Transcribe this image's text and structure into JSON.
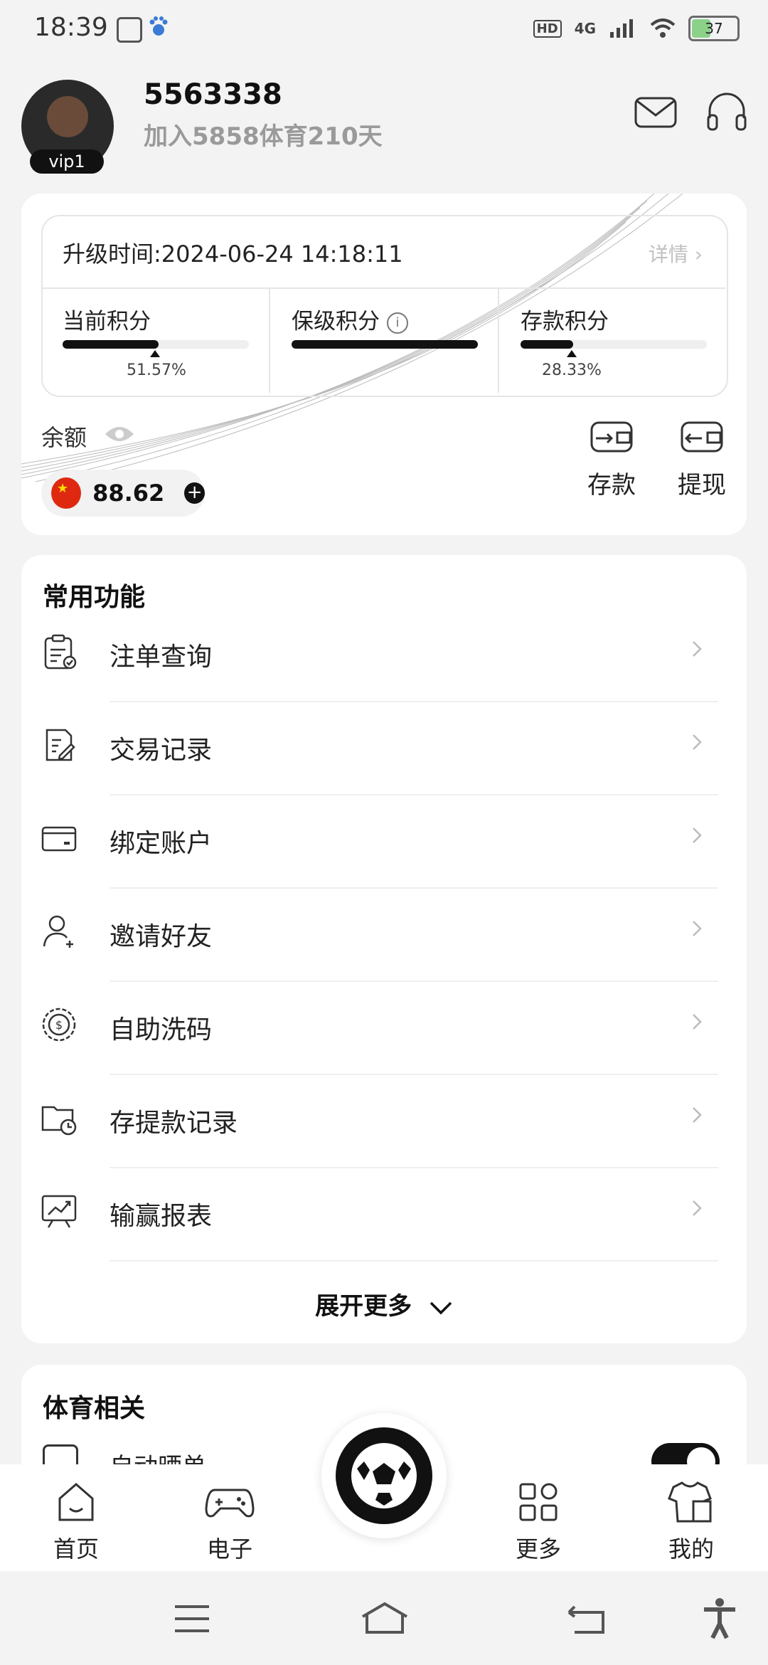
{
  "status_bar": {
    "time": "18:39",
    "network": "4G",
    "hd": "HD",
    "battery": "37"
  },
  "header": {
    "vip_level": "vip1",
    "user_id": "5563338",
    "join_text": "加入5858体育210天",
    "mail_icon": "mail-icon",
    "support_icon": "headset-icon"
  },
  "vip_card": {
    "upgrade_time": "升级时间:2024-06-24 14:18:11",
    "detail_label": "详情",
    "metrics": [
      {
        "label": "当前积分",
        "progress": 0.5157,
        "percent_text": "51.57%"
      },
      {
        "label": "保级积分",
        "progress": 1.0,
        "percent_text": ""
      },
      {
        "label": "存款积分",
        "progress": 0.2833,
        "percent_text": "28.33%"
      }
    ],
    "balance_label": "余额",
    "balance_amount": "88.62",
    "deposit_label": "存款",
    "withdraw_label": "提现"
  },
  "common_functions": {
    "title": "常用功能",
    "items": [
      {
        "label": "注单查询",
        "icon": "clipboard-check-icon"
      },
      {
        "label": "交易记录",
        "icon": "document-edit-icon"
      },
      {
        "label": "绑定账户",
        "icon": "card-icon"
      },
      {
        "label": "邀请好友",
        "icon": "user-plus-icon"
      },
      {
        "label": "自助洗码",
        "icon": "coin-dollar-icon"
      },
      {
        "label": "存提款记录",
        "icon": "folder-clock-icon"
      },
      {
        "label": "输赢报表",
        "icon": "chart-board-icon"
      }
    ],
    "expand_label": "展开更多"
  },
  "sports_section": {
    "title": "体育相关",
    "first_item": "自动晒单"
  },
  "tab_bar": {
    "tabs": [
      {
        "label": "首页",
        "icon": "home-icon"
      },
      {
        "label": "电子",
        "icon": "gamepad-icon"
      },
      {
        "label": "更多",
        "icon": "grid-icon"
      },
      {
        "label": "我的",
        "icon": "shirt-icon"
      }
    ]
  },
  "colors": {
    "background": "#f3f3f3",
    "card": "#ffffff",
    "accent": "#111111",
    "muted": "#9a9a9a"
  }
}
